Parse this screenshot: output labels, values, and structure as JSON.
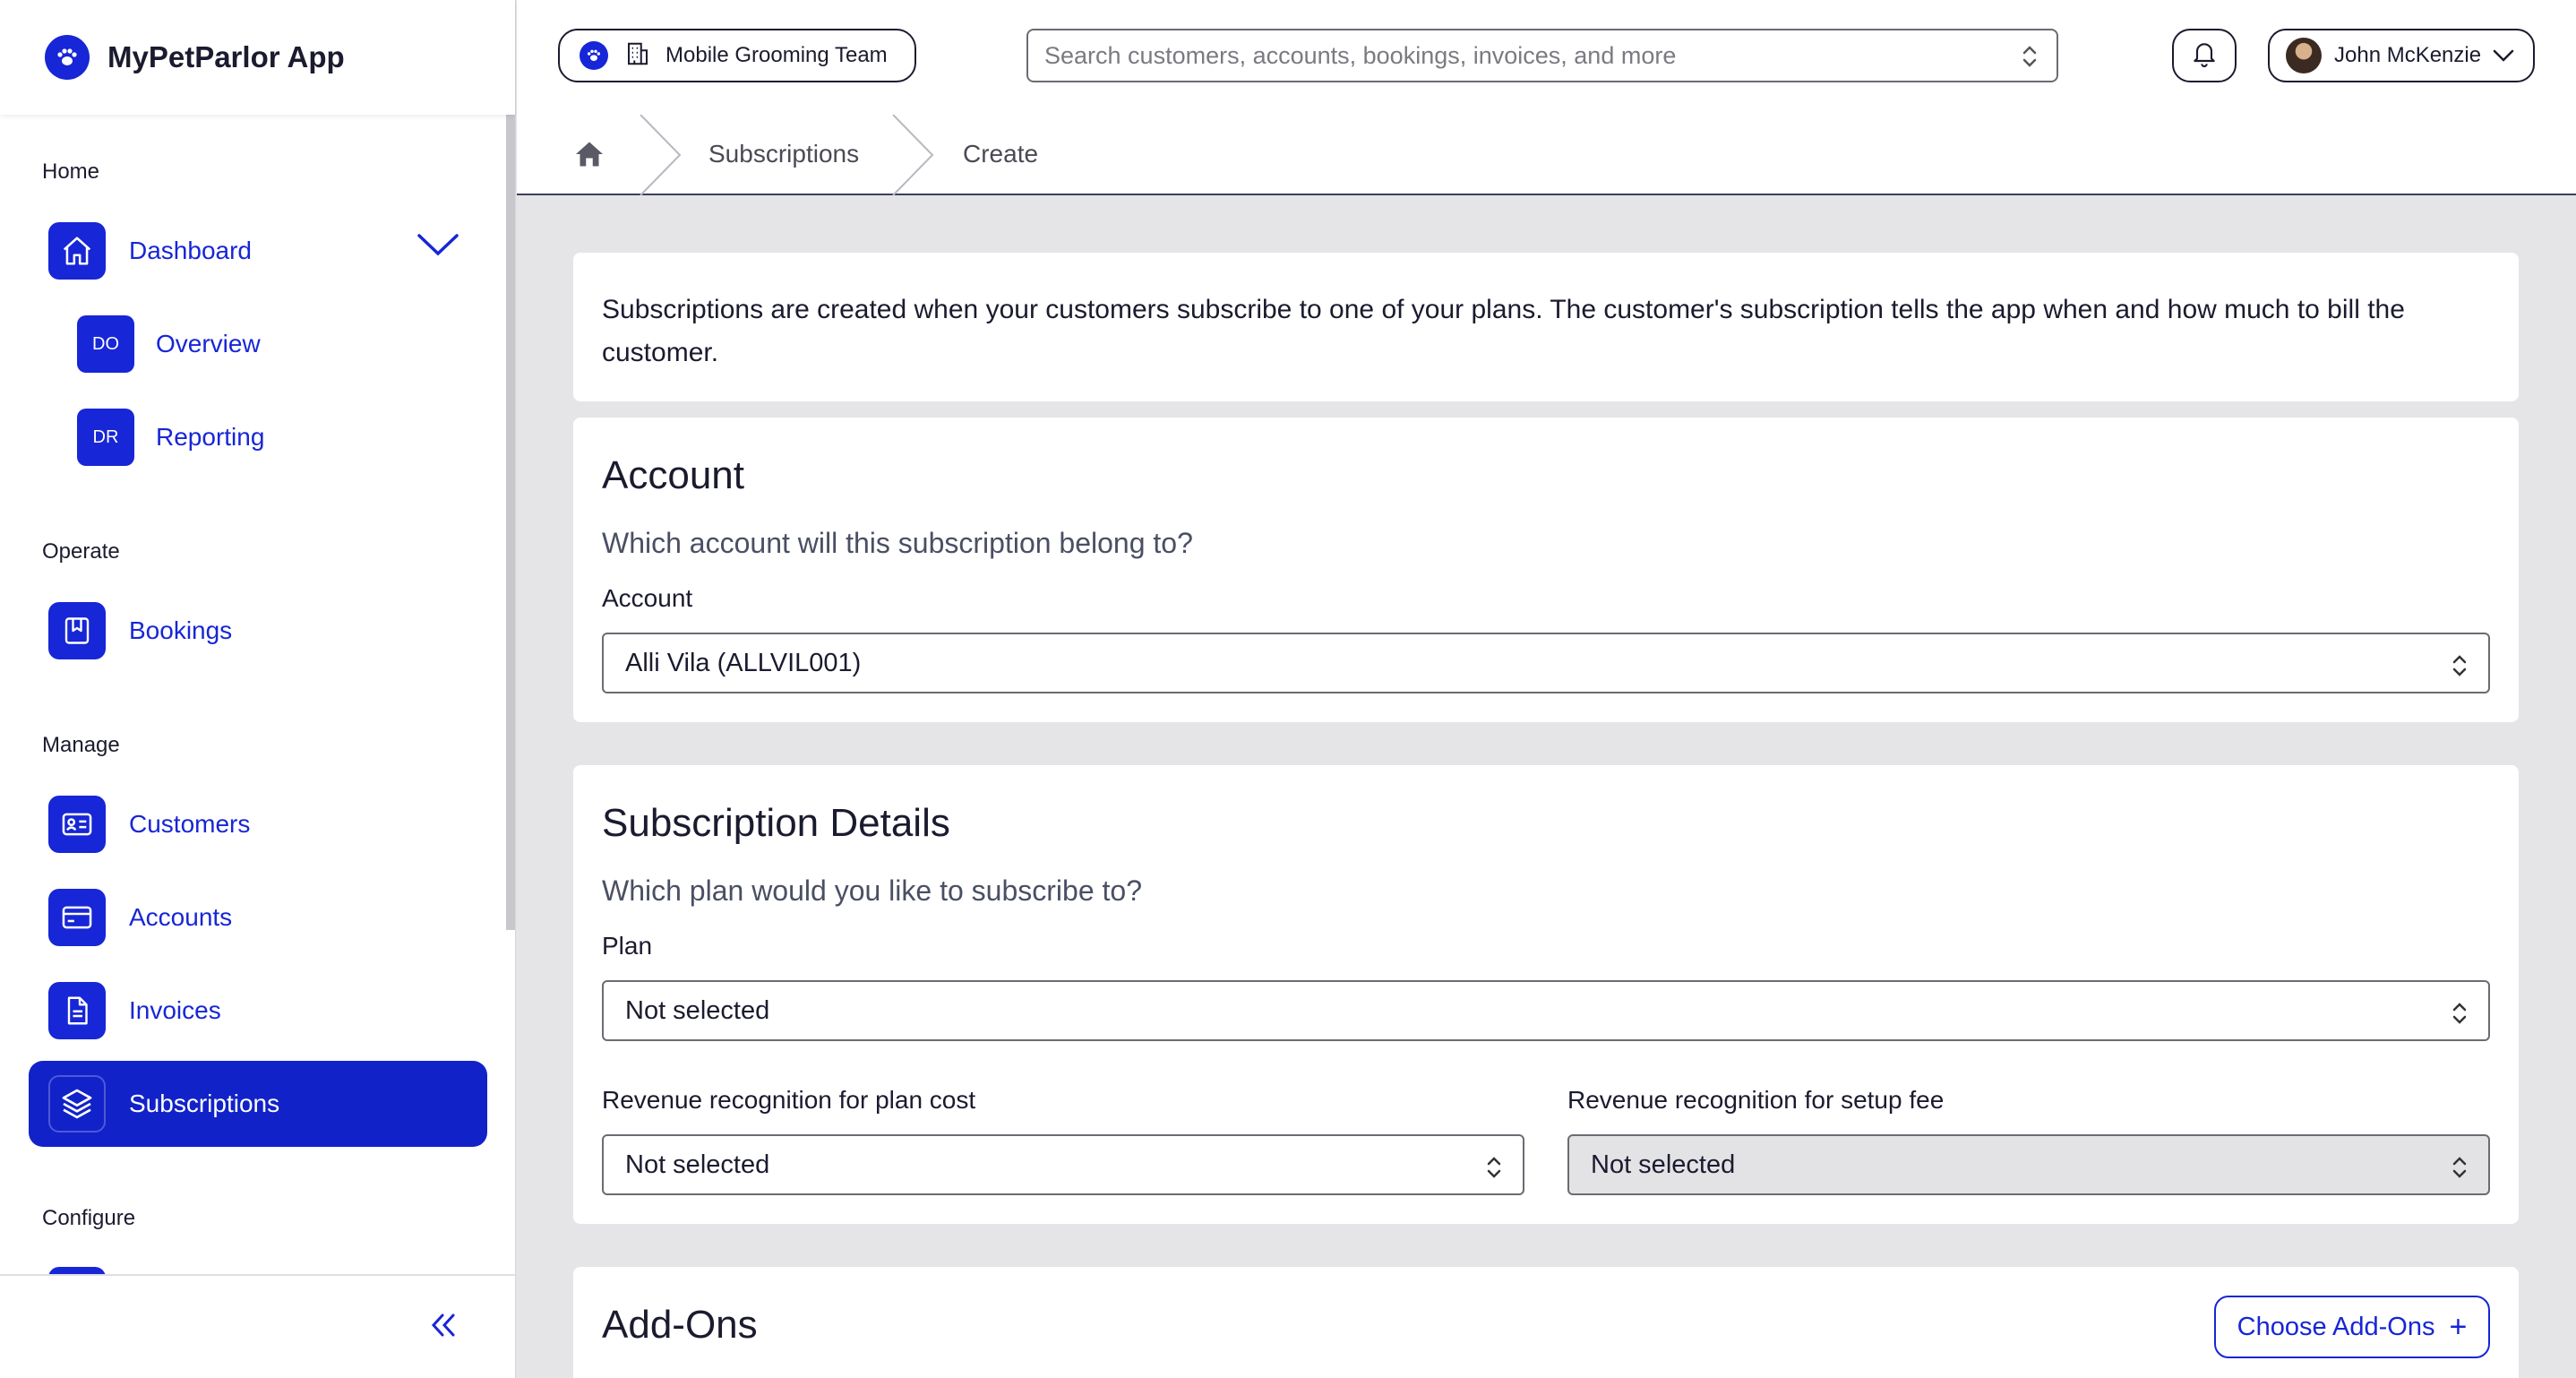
{
  "app": {
    "name": "MyPetParlor App"
  },
  "sidebar": {
    "sections": {
      "home": "Home",
      "operate": "Operate",
      "manage": "Manage",
      "configure": "Configure"
    },
    "dashboard": {
      "label": "Dashboard"
    },
    "dashboard_sub": [
      {
        "badge": "DO",
        "label": "Overview"
      },
      {
        "badge": "DR",
        "label": "Reporting"
      }
    ],
    "bookings": {
      "label": "Bookings"
    },
    "customers": {
      "label": "Customers"
    },
    "accounts": {
      "label": "Accounts"
    },
    "invoices": {
      "label": "Invoices"
    },
    "subscriptions": {
      "label": "Subscriptions",
      "active": true
    }
  },
  "topbar": {
    "team": "Mobile Grooming Team",
    "search_placeholder": "Search customers, accounts, bookings, invoices, and more",
    "user_name": "John McKenzie"
  },
  "breadcrumb": [
    "Subscriptions",
    "Create"
  ],
  "intro_text": "Subscriptions are created when your customers subscribe to one of your plans. The customer's subscription tells the app when and how much to bill the customer.",
  "account_card": {
    "title": "Account",
    "question": "Which account will this subscription belong to?",
    "field_label": "Account",
    "value": "Alli Vila (ALLVIL001)"
  },
  "details_card": {
    "title": "Subscription Details",
    "question": "Which plan would you like to subscribe to?",
    "plan_label": "Plan",
    "plan_value": "Not selected",
    "rev_plan_label": "Revenue recognition for plan cost",
    "rev_plan_value": "Not selected",
    "rev_setup_label": "Revenue recognition for setup fee",
    "rev_setup_value": "Not selected"
  },
  "addons_card": {
    "title": "Add-Ons",
    "button_label": "Choose Add-Ons"
  },
  "colors": {
    "primary": "#1726d6",
    "active_nav": "#1222c9",
    "background": "#e5e5e7"
  }
}
